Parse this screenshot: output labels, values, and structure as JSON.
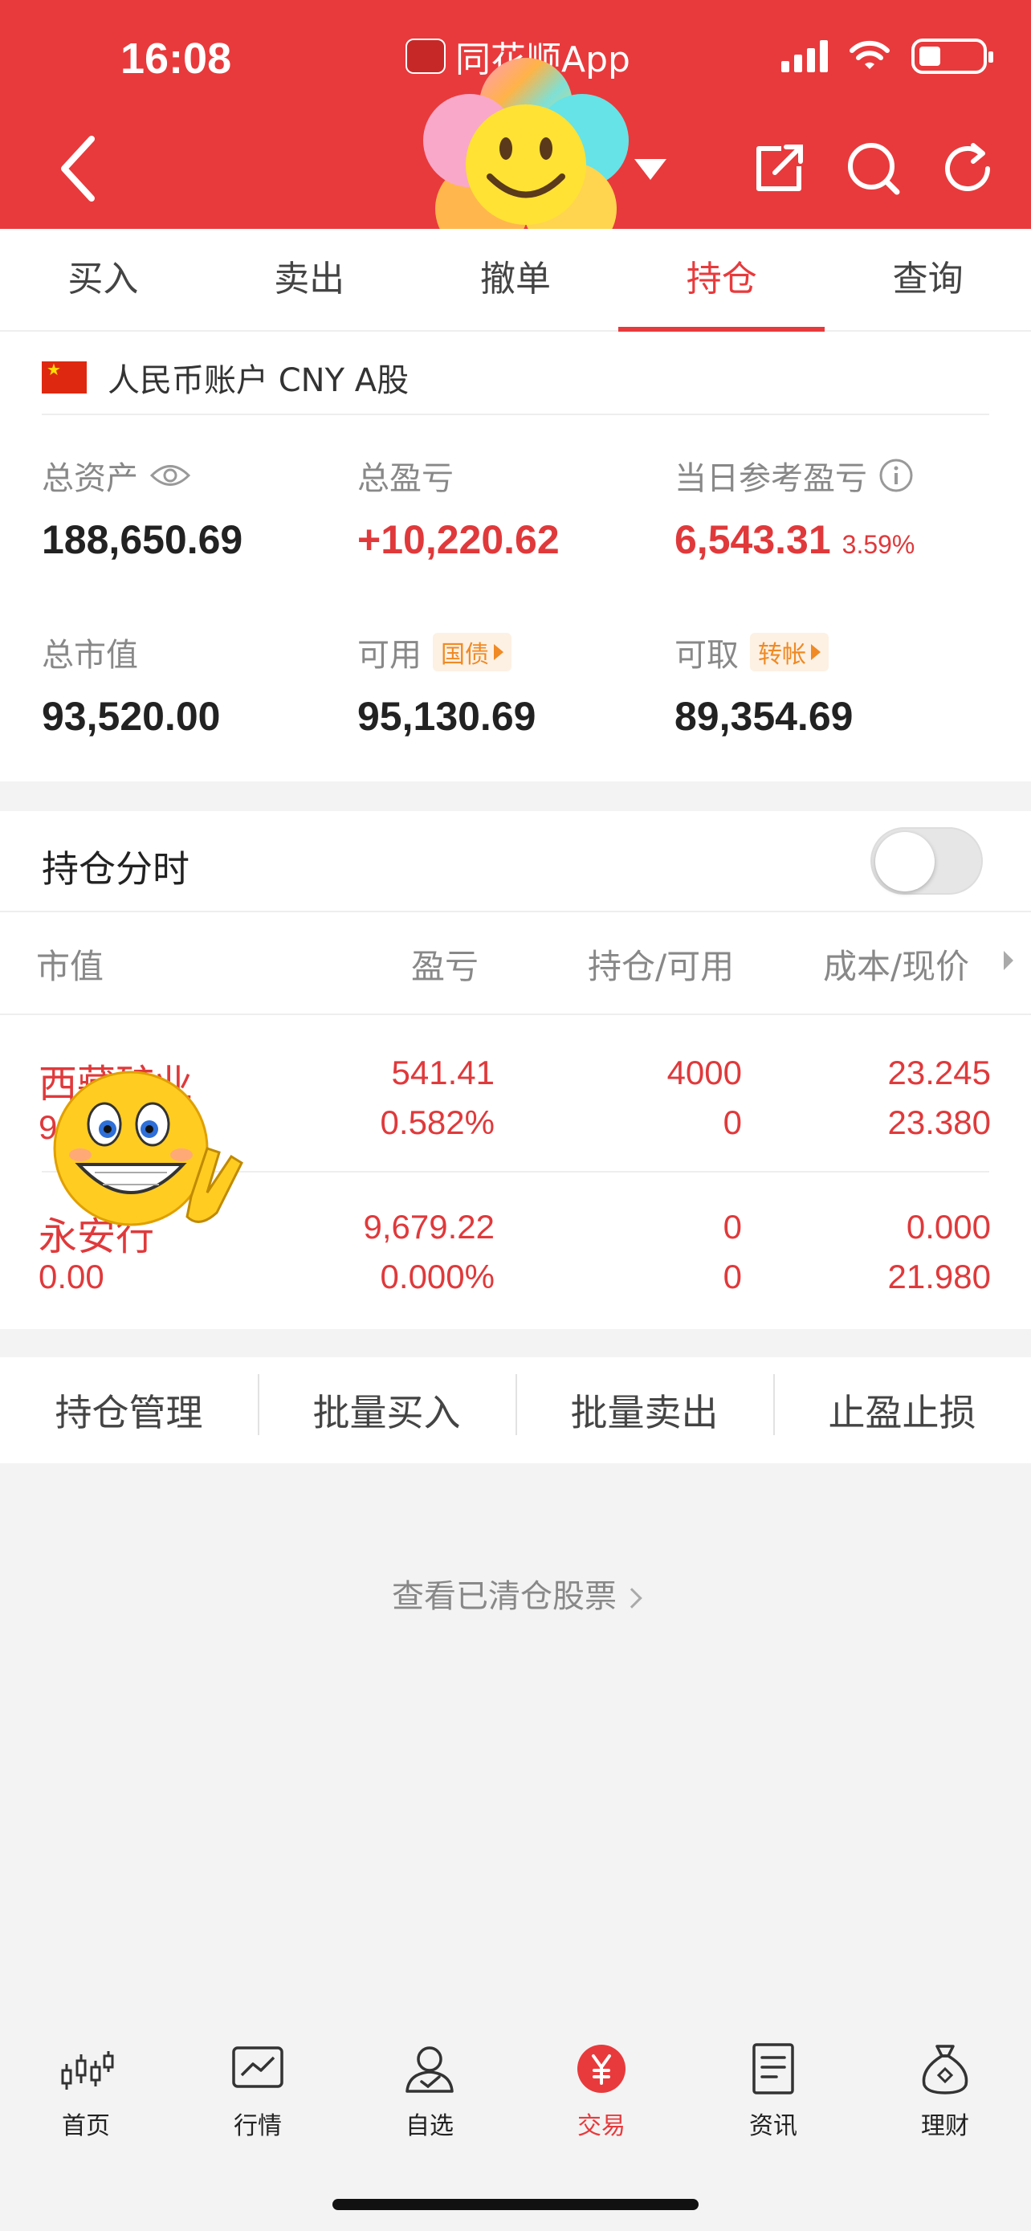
{
  "status_bar": {
    "time": "16:08",
    "app_name": "同花顺App"
  },
  "tabs": [
    {
      "label": "买入",
      "active": false
    },
    {
      "label": "卖出",
      "active": false
    },
    {
      "label": "撤单",
      "active": false
    },
    {
      "label": "持仓",
      "active": true
    },
    {
      "label": "查询",
      "active": false
    }
  ],
  "account": {
    "name": "人民币账户 CNY A股",
    "total_assets_label": "总资产",
    "total_assets": "188,650.69",
    "total_pl_label": "总盈亏",
    "total_pl": "+10,220.62",
    "daily_pl_label": "当日参考盈亏",
    "daily_pl": "6,543.31",
    "daily_pl_pct": "3.59%",
    "market_value_label": "总市值",
    "market_value": "93,520.00",
    "available_label": "可用",
    "available_tag": "国债",
    "available": "95,130.69",
    "withdrawable_label": "可取",
    "withdrawable_tag": "转帐",
    "withdrawable": "89,354.69"
  },
  "holdings": {
    "title": "持仓分时",
    "toggle_on": false,
    "columns": [
      "市值",
      "盈亏",
      "持仓/可用",
      "成本/现价"
    ],
    "rows": [
      {
        "name": "西藏矿业",
        "value": "9",
        "pl": "541.41",
        "pl_pct": "0.582%",
        "hold": "4000",
        "avail": "0",
        "cost": "23.245",
        "price": "23.380"
      },
      {
        "name": "永安行",
        "value": "0.00",
        "pl": "9,679.22",
        "pl_pct": "0.000%",
        "hold": "0",
        "avail": "0",
        "cost": "0.000",
        "price": "21.980"
      }
    ]
  },
  "actions": [
    "持仓管理",
    "批量买入",
    "批量卖出",
    "止盈止损"
  ],
  "cleared_link": "查看已清仓股票",
  "tabbar": [
    {
      "label": "首页",
      "icon": "candlestick-icon",
      "active": false
    },
    {
      "label": "行情",
      "icon": "chart-icon",
      "active": false
    },
    {
      "label": "自选",
      "icon": "user-check-icon",
      "active": false
    },
    {
      "label": "交易",
      "icon": "yuan-icon",
      "active": true
    },
    {
      "label": "资讯",
      "icon": "document-icon",
      "active": false
    },
    {
      "label": "理财",
      "icon": "money-bag-icon",
      "active": false
    }
  ],
  "colors": {
    "brand_red": "#e83a3c",
    "gain_red": "#e0393b",
    "tag_orange": "#f08a24"
  }
}
